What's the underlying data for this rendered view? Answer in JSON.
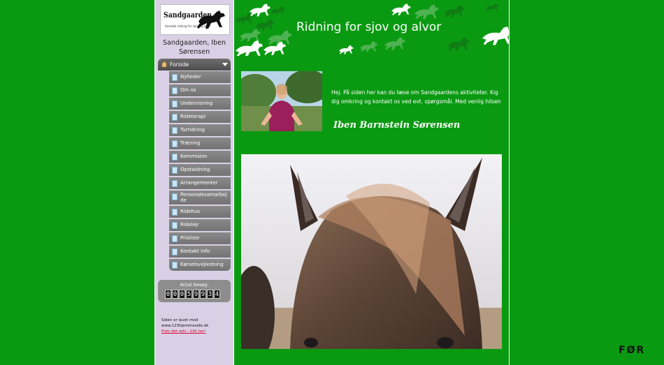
{
  "logo": {
    "text": "Sandgaarden",
    "subtitle": "Islandsk ridning for sjov og alvor"
  },
  "site_name": "Sandgaarden, Iben Sørensen",
  "nav": {
    "home_label": "Forside",
    "items": [
      {
        "label": "Nyheder"
      },
      {
        "label": "Om os"
      },
      {
        "label": "Undervisning"
      },
      {
        "label": "Rideterapi"
      },
      {
        "label": "Turridning"
      },
      {
        "label": "Træning"
      },
      {
        "label": "Kommision"
      },
      {
        "label": "Opstaldning"
      },
      {
        "label": "Arrangementer"
      },
      {
        "label": "Personalesamarbejde"
      },
      {
        "label": "Ridehus"
      },
      {
        "label": "Ridelejr"
      },
      {
        "label": "Prisliste"
      },
      {
        "label": "Kontakt info"
      },
      {
        "label": "Kørselsvejledning"
      }
    ]
  },
  "counter": {
    "label": "Antal besøg:",
    "digits": [
      "0",
      "0",
      "0",
      "5",
      "9",
      "9",
      "3",
      "4"
    ]
  },
  "footer": {
    "line1": "Siden er lavet med",
    "line2": "www.123hjemmeside.dk",
    "link": "Prøv det selv - klik her!"
  },
  "banner": {
    "title": "Ridning for sjov og alvor"
  },
  "intro_text": "Hej. På siden her kan du læse om Sandgaardens aktiviteter. Kig dig omkring og kontakt os ved evt. spørgsmål. Med venlig hilsen",
  "signature": "Iben Barnstein Sørensen",
  "watermark": "FØR",
  "colors": {
    "page_bg": "#0a9a12",
    "sidebar_bg": "#d9d0e6",
    "nav_item": "#7d7d7d"
  }
}
